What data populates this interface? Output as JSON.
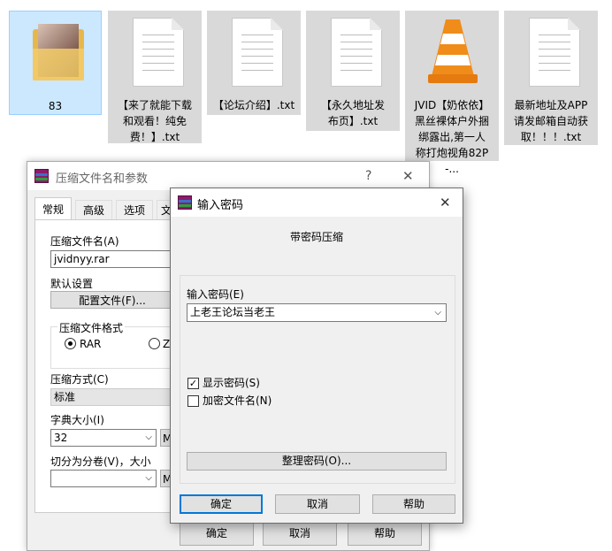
{
  "desktop": {
    "files": [
      {
        "label": "83"
      },
      {
        "label": "【来了就能下载和观看！纯免费！】.txt"
      },
      {
        "label": "【论坛介绍】.txt"
      },
      {
        "label": "【永久地址发布页】.txt"
      },
      {
        "label": "JVID【奶依依】黑丝裸体户外捆绑露出,第一人称打炮视角82P-..."
      },
      {
        "label": "最新地址及APP请发邮箱自动获取！！！.txt"
      }
    ]
  },
  "archive_dialog": {
    "title": "压缩文件名和参数",
    "help_button": "?",
    "close_button": "✕",
    "tabs": [
      "常规",
      "高级",
      "选项",
      "文"
    ],
    "archive_name_label": "压缩文件名(A)",
    "archive_name_value": "jvidnyy.rar",
    "default_settings_label": "默认设置",
    "profiles_button": "配置文件(F)...",
    "format_group_label": "压缩文件格式",
    "format_options": [
      "RAR",
      "ZI"
    ],
    "method_label": "压缩方式(C)",
    "method_value": "标准",
    "dict_label": "字典大小(I)",
    "dict_value": "32",
    "dict_unit": "M",
    "split_label": "切分为分卷(V)，大小",
    "split_value": "",
    "split_unit": "M",
    "ok_button": "确定",
    "cancel_button": "取消",
    "help_bottom_button": "帮助"
  },
  "password_dialog": {
    "title": "输入密码",
    "close_button": "✕",
    "heading": "带密码压缩",
    "password_label": "输入密码(E)",
    "password_value": "上老王论坛当老王",
    "show_password_label": "显示密码(S)",
    "show_password_checked": "✓",
    "encrypt_names_label": "加密文件名(N)",
    "organize_button": "整理密码(O)...",
    "ok_button": "确定",
    "cancel_button": "取消",
    "help_button": "帮助"
  }
}
